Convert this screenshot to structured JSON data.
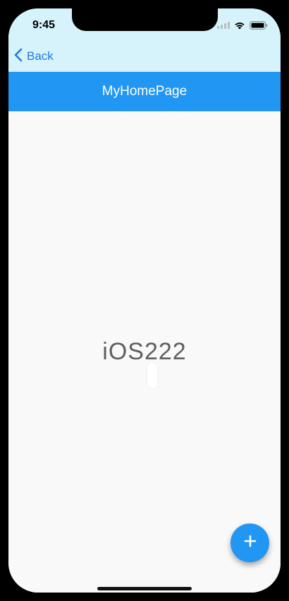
{
  "status_bar": {
    "time": "9:45"
  },
  "nav": {
    "back_label": "Back",
    "back_icon": "chevron-left-icon"
  },
  "app_bar": {
    "title": "MyHomePage"
  },
  "main": {
    "center_text": "iOS222"
  },
  "fab": {
    "icon": "plus-icon"
  },
  "colors": {
    "app_bar": "#2196f3",
    "ios_header": "#d6f3fb",
    "back_accent": "#1f7ae0",
    "background": "#f9f9f9",
    "text_gray": "#5f5f5f"
  }
}
